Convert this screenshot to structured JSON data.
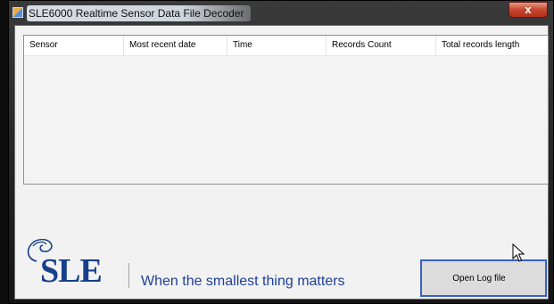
{
  "window": {
    "title": "SLE6000 Realtime Sensor Data File Decoder",
    "close_glyph": "x"
  },
  "table": {
    "columns": [
      "Sensor",
      "Most recent date",
      "Time",
      "Records Count",
      "Total records length"
    ],
    "rows": []
  },
  "branding": {
    "logo_text": "SLE",
    "tagline": "When the smallest thing matters",
    "brand_color": "#163f8c"
  },
  "actions": {
    "open_log_label": "Open Log file"
  },
  "icons": {
    "app": "app-icon",
    "close": "close-icon",
    "cursor": "mouse-pointer-icon",
    "logo": "sle-logo-swirl-icon"
  }
}
